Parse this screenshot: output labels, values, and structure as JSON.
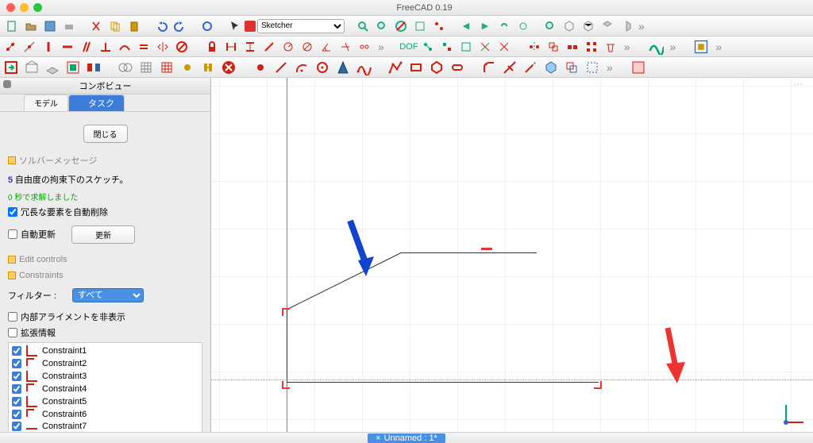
{
  "title": "FreeCAD 0.19",
  "workbench": {
    "selected": "Sketcher"
  },
  "panel": {
    "title": "コンボビュー"
  },
  "tabs": {
    "model": "モデル",
    "task": "タスク"
  },
  "task": {
    "close_btn": "閉じる",
    "solver_section": "ソルバーメッセージ",
    "dof_msg_num": "5",
    "dof_msg": "自由度の拘束下のスケッチ。",
    "solve_msg": "0 秒で求解しました",
    "auto_remove": "冗長な要素を自動削除",
    "auto_update": "自動更新",
    "update_btn": "更新",
    "edit_controls": "Edit controls",
    "constraints_section": "Constraints",
    "filter_label": "フィルター :",
    "filter_value": "すべて",
    "hide_internal": "内部アライメントを非表示",
    "ext_info": "拡張情報"
  },
  "constraints": [
    "Constraint1",
    "Constraint2",
    "Constraint3",
    "Constraint4",
    "Constraint5",
    "Constraint6",
    "Constraint7"
  ],
  "status": {
    "doc": "Unnamed : 1*"
  },
  "top_indicator": "'''"
}
